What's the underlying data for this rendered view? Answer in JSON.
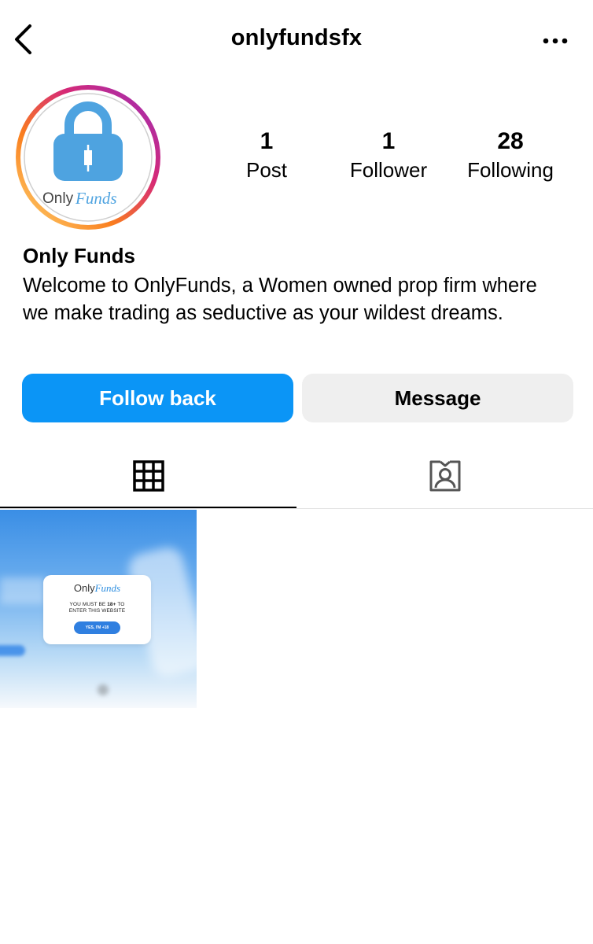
{
  "header": {
    "username": "onlyfundsfx",
    "back_icon": "chevron-left-icon",
    "more_icon": "more-horizontal-icon"
  },
  "profile": {
    "avatar": {
      "logo_text_only": "Only",
      "logo_text_funds": "Funds",
      "icon": "padlock-candlestick-icon",
      "ring_colors": [
        "#feda75",
        "#fa7e1e",
        "#d62976",
        "#962fbf"
      ],
      "logo_color": "#4ea3e0"
    },
    "stats": [
      {
        "value": "1",
        "label": "Post"
      },
      {
        "value": "1",
        "label": "Follower"
      },
      {
        "value": "28",
        "label": "Following"
      }
    ],
    "display_name": "Only Funds",
    "bio": "Welcome to OnlyFunds, a Women owned prop firm where we make trading as seductive as your wildest dreams."
  },
  "actions": {
    "follow_back_label": "Follow back",
    "message_label": "Message",
    "follow_color": "#0b95f6"
  },
  "tabs": [
    {
      "icon": "grid-icon",
      "active": true
    },
    {
      "icon": "tagged-person-icon",
      "active": false
    }
  ],
  "posts": [
    {
      "logo_only": "Only",
      "logo_funds": "Funds",
      "line1_prefix": "YOU MUST BE ",
      "line1_bold": "18+",
      "line1_suffix": " TO",
      "line2": "ENTER THIS WEBSITE",
      "button": "YES, I'M +18"
    }
  ]
}
